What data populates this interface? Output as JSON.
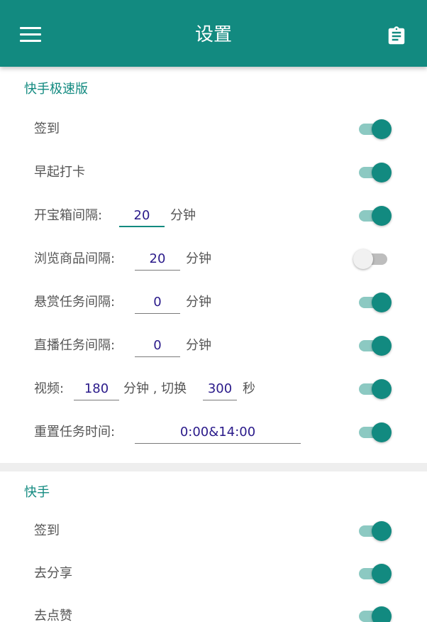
{
  "appbar": {
    "title": "设置",
    "menu_icon": "menu-icon",
    "action_icon": "clipboard-icon",
    "color": "#128a80"
  },
  "sections": [
    {
      "title": "快手极速版",
      "rows": [
        {
          "label": "签到",
          "enabled": true
        },
        {
          "label": "早起打卡",
          "enabled": true
        },
        {
          "label": "开宝箱间隔:",
          "value": "20",
          "unit": "分钟",
          "enabled": true
        },
        {
          "label": "浏览商品间隔:",
          "value": "20",
          "unit": "分钟",
          "enabled": false
        },
        {
          "label": "悬赏任务间隔:",
          "value": "0",
          "unit": "分钟",
          "enabled": true
        },
        {
          "label": "直播任务间隔:",
          "value": "0",
          "unit": "分钟",
          "enabled": true
        },
        {
          "label": "视频:",
          "value": "180",
          "unit": "分钟 , 切换",
          "value2": "300",
          "unit2": "秒",
          "enabled": true
        },
        {
          "label": "重置任务时间:",
          "value": "0:00&14:00",
          "enabled": true
        }
      ]
    },
    {
      "title": "快手",
      "rows": [
        {
          "label": "签到",
          "enabled": true
        },
        {
          "label": "去分享",
          "enabled": true
        },
        {
          "label": "去点赞",
          "enabled": true
        }
      ]
    }
  ],
  "colors": {
    "accent": "#128a80",
    "switch_track_on": "#8cc9c2",
    "switch_off": "#f1f1f1",
    "input_text": "#2a1a8a"
  }
}
